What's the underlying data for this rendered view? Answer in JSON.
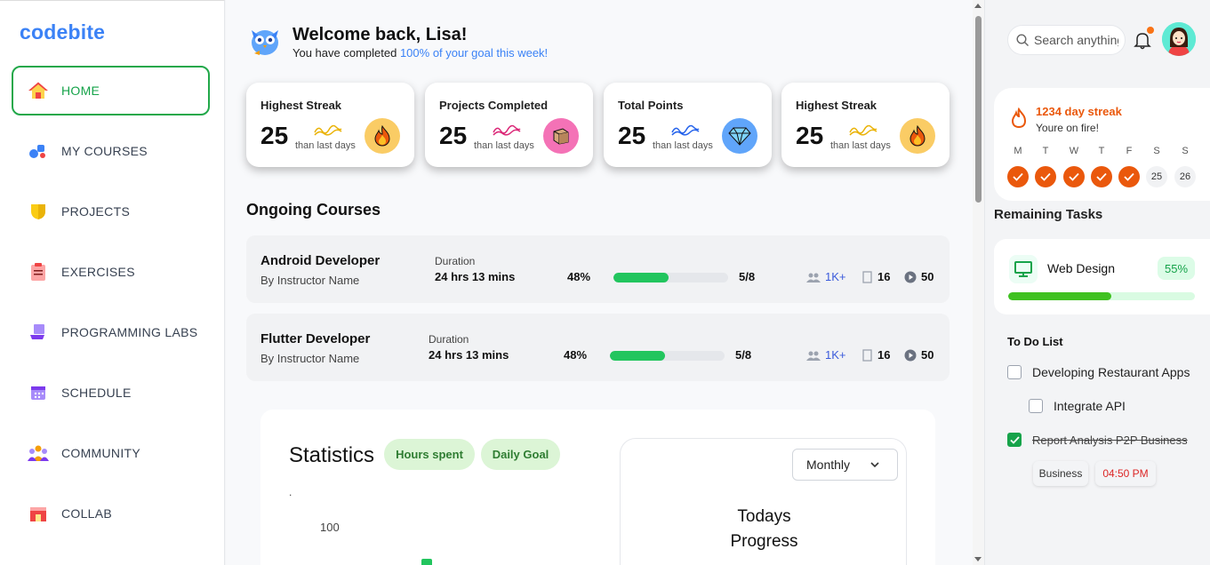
{
  "sidebar": {
    "logo": "codebite",
    "items": [
      {
        "label": "HOME",
        "icon": "home-icon",
        "active": true
      },
      {
        "label": "MY COURSES",
        "icon": "courses-icon"
      },
      {
        "label": "PROJECTS",
        "icon": "projects-icon"
      },
      {
        "label": "EXERCISES",
        "icon": "exercises-icon"
      },
      {
        "label": "PROGRAMMING LABS",
        "icon": "labs-icon"
      },
      {
        "label": "SCHEDULE",
        "icon": "schedule-icon"
      },
      {
        "label": "COMMUNITY",
        "icon": "community-icon"
      },
      {
        "label": "COLLAB",
        "icon": "collab-icon"
      }
    ]
  },
  "welcome": {
    "title": "Welcome back, Lisa!",
    "sub_prefix": "You have completed ",
    "sub_highlight": "100% of your goal this week!"
  },
  "stats": [
    {
      "label": "Highest Streak",
      "value": "25",
      "sub": "than last days",
      "icon": "fire-icon",
      "wave_color": "#eab308",
      "badge_color": "#facc65"
    },
    {
      "label": "Projects Completed",
      "value": "25",
      "sub": "than last days",
      "icon": "box-icon",
      "wave_color": "#db2777",
      "badge_color": "#f472b6"
    },
    {
      "label": "Total Points",
      "value": "25",
      "sub": "than last days",
      "icon": "diamond-icon",
      "wave_color": "#2563eb",
      "badge_color": "#60a5fa"
    },
    {
      "label": "Highest Streak",
      "value": "25",
      "sub": "than last days",
      "icon": "fire-icon",
      "wave_color": "#eab308",
      "badge_color": "#facc65"
    }
  ],
  "ongoing": {
    "title": "Ongoing Courses",
    "courses": [
      {
        "name": "Android Developer",
        "instructor": "By Instructor Name",
        "duration_label": "Duration",
        "duration": "24 hrs 13 mins",
        "percent": "48%",
        "progress": 0.48,
        "fraction": "5/8",
        "students": "1K+",
        "lessons": "16",
        "videos": "50"
      },
      {
        "name": "Flutter Developer",
        "instructor": "By Instructor Name",
        "duration_label": "Duration",
        "duration": "24 hrs 13 mins",
        "percent": "48%",
        "progress": 0.48,
        "fraction": "5/8",
        "students": "1K+",
        "lessons": "16",
        "videos": "50"
      }
    ]
  },
  "statistics": {
    "title": "Statistics",
    "pills": [
      "Hours spent",
      "Daily Goal"
    ],
    "dot": ".",
    "axis_label": "100",
    "period": "Monthly",
    "progress_title": "Todays Progress"
  },
  "right": {
    "search_placeholder": "Search anything",
    "streak_title": "1234 day streak",
    "streak_sub": "Youre on fire!",
    "days": [
      {
        "label": "M",
        "done": true,
        "date": ""
      },
      {
        "label": "T",
        "done": true,
        "date": ""
      },
      {
        "label": "W",
        "done": true,
        "date": ""
      },
      {
        "label": "T",
        "done": true,
        "date": ""
      },
      {
        "label": "F",
        "done": true,
        "date": ""
      },
      {
        "label": "S",
        "done": false,
        "date": "25"
      },
      {
        "label": "S",
        "done": false,
        "date": "26"
      }
    ],
    "remaining_title": "Remaining Tasks",
    "task": {
      "name": "Web Design",
      "percent": "55%",
      "progress": 0.55
    },
    "todo_title": "To Do List",
    "todos": [
      {
        "text": "Developing Restaurant Apps",
        "done": false
      },
      {
        "text": "Integrate API",
        "done": false
      },
      {
        "text": "Report Analysis P2P Business",
        "done": true
      }
    ],
    "tags": [
      "Business",
      "04:50 PM"
    ]
  }
}
